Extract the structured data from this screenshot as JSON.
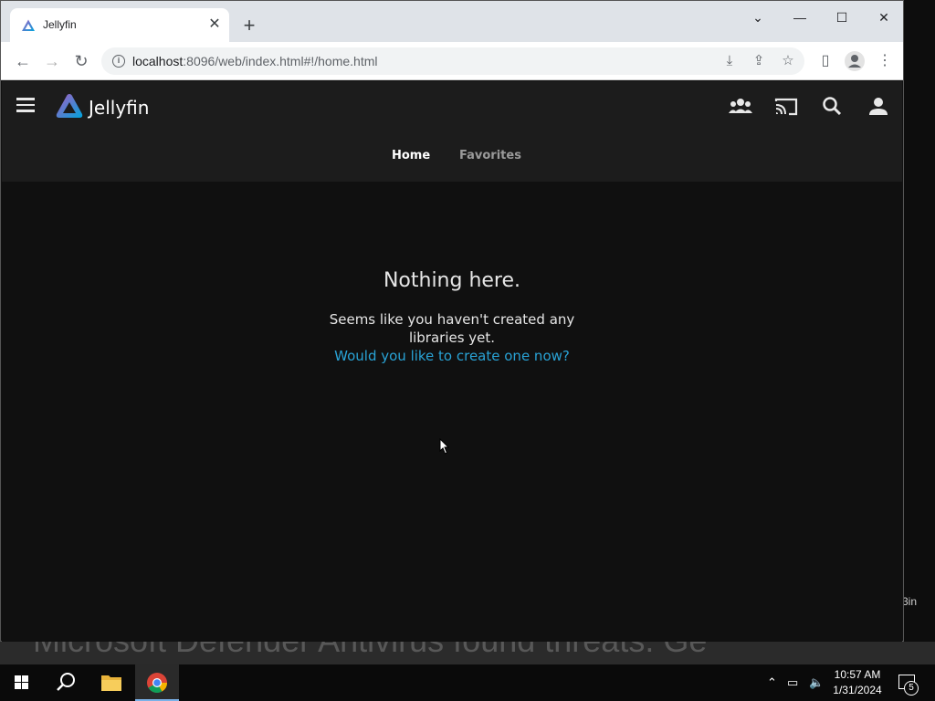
{
  "browser": {
    "tab_title": "Jellyfin",
    "url_host": "localhost",
    "url_rest": ":8096/web/index.html#!/home.html"
  },
  "app": {
    "brand": "Jellyfin",
    "tabs": [
      {
        "label": "Home",
        "active": true
      },
      {
        "label": "Favorites",
        "active": false
      }
    ],
    "empty_title": "Nothing here.",
    "empty_message": "Seems like you haven't created any libraries yet.",
    "empty_link": "Would you like to create one now?",
    "accent_color": "#29a3d6"
  },
  "desktop": {
    "background_toast": "Microsoft Defender Antivirus found threats. Ge",
    "side_text": "3in"
  },
  "taskbar": {
    "time": "10:57 AM",
    "date": "1/31/2024",
    "notification_count": "5"
  }
}
